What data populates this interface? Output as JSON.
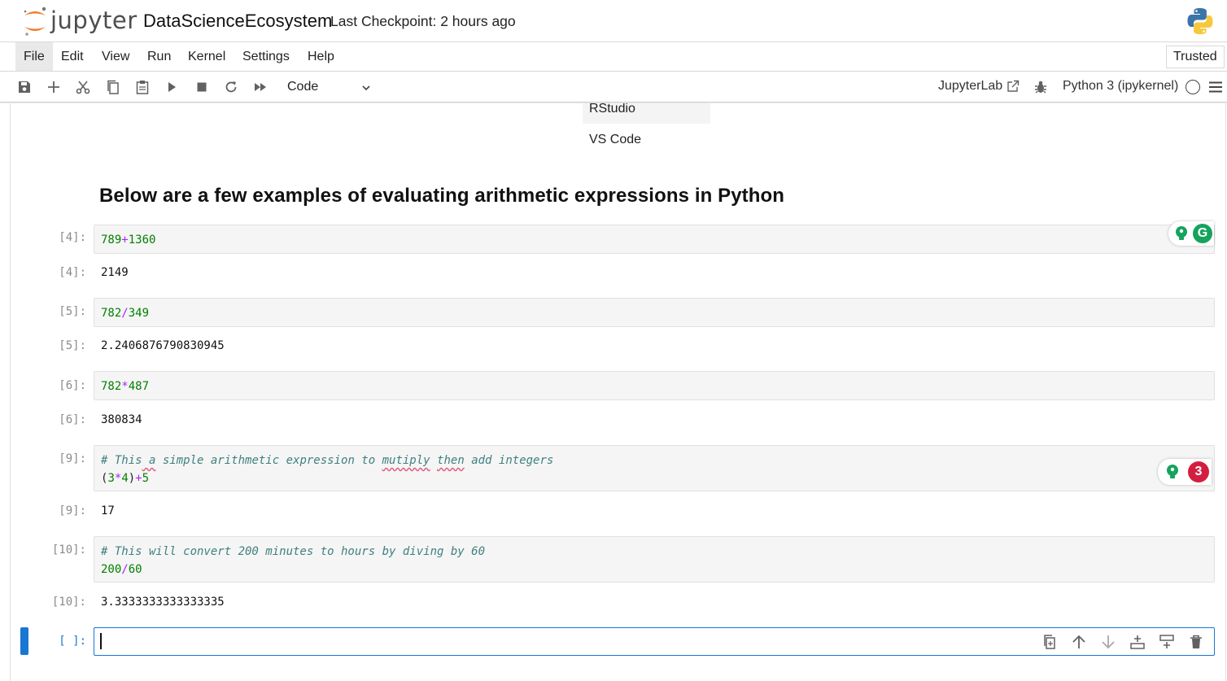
{
  "header": {
    "logo_text": "jupyter",
    "notebook_title": "DataScienceEcosystem",
    "checkpoint_text": "Last Checkpoint: 2 hours ago",
    "logo_icon": "jupyter-logo-icon",
    "python_icon": "python-logo-icon"
  },
  "menu": {
    "items": [
      "File",
      "Edit",
      "View",
      "Run",
      "Kernel",
      "Settings",
      "Help"
    ],
    "active": "File",
    "trusted_label": "Trusted"
  },
  "toolbar": {
    "buttons": [
      "save-icon",
      "add-cell-icon",
      "cut-icon",
      "copy-icon",
      "paste-icon",
      "run-icon",
      "stop-icon",
      "restart-icon",
      "fast-forward-icon"
    ],
    "cell_type": "Code",
    "jupyterlab_label": "JupyterLab",
    "kernel_name": "Python 3 (ipykernel)"
  },
  "notebook": {
    "table_rows": [
      "RStudio",
      "VS Code"
    ],
    "heading": "Below are a few examples of evaluating arithmetic expressions in Python",
    "cells": [
      {
        "prompt": "[4]:",
        "out_prompt": "[4]:",
        "output": "2149"
      },
      {
        "prompt": "[5]:",
        "out_prompt": "[5]:",
        "output": "2.2406876790830945"
      },
      {
        "prompt": "[6]:",
        "out_prompt": "[6]:",
        "output": "380834"
      },
      {
        "prompt": "[9]:",
        "out_prompt": "[9]:",
        "output": "17"
      },
      {
        "prompt": "[10]:",
        "out_prompt": "[10]:",
        "output": "3.3333333333333335"
      }
    ],
    "code": {
      "c4": {
        "a": "789",
        "op": "+",
        "b": "1360"
      },
      "c5": {
        "a": "782",
        "op": "/",
        "b": "349"
      },
      "c6": {
        "a": "782",
        "op": "*",
        "b": "487"
      },
      "c9": {
        "comment_parts": [
          "# This",
          " a",
          " simple arithmetic expression to ",
          "mutiply",
          " ",
          "then",
          " add integers"
        ],
        "l2_open": "(",
        "l2_a": "3",
        "l2_op1": "*",
        "l2_b": "4",
        "l2_close": ")",
        "l2_op2": "+",
        "l2_c": "5"
      },
      "c10": {
        "comment": "# This will convert 200 minutes to hours by diving by 60",
        "a": "200",
        "op": "/",
        "b": "60"
      }
    },
    "empty_prompt": "[ ]:",
    "grammarly_badge_count": "3",
    "colors": {
      "accent": "#1976d2",
      "grammarly_green": "#15a35d",
      "grammarly_red": "#d31f3f"
    }
  }
}
